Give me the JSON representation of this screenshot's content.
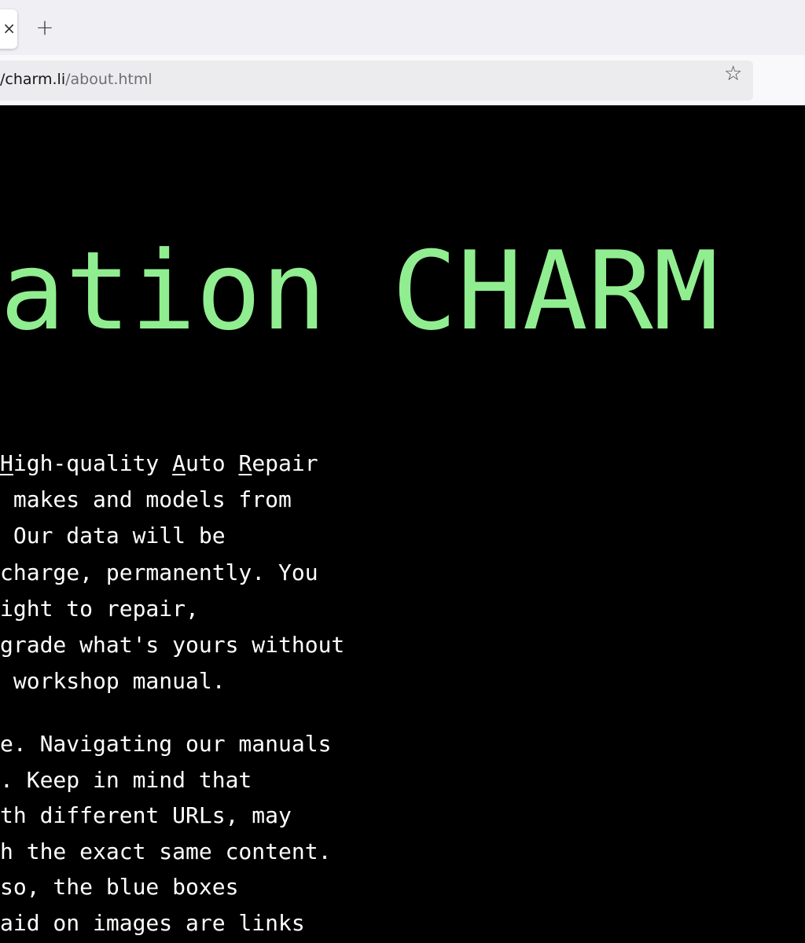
{
  "browser": {
    "tab_close": "×",
    "new_tab": "+",
    "url_host": "/charm.li",
    "url_path": "/about.html",
    "bookmark_icon": "star-icon"
  },
  "page": {
    "heading": "ation CHARM",
    "heading_color": "#90ee90",
    "paragraph1": {
      "line1": {
        "u1": "H",
        "t1": "igh-quality ",
        "u2": "A",
        "t2": "uto ",
        "u3": "R",
        "t3": "epair"
      },
      "lines": [
        " makes and models from",
        " Our data will be",
        "charge, permanently. You",
        "ight to repair,",
        "grade what's yours without",
        " workshop manual."
      ]
    },
    "paragraph2": {
      "lines": [
        "e. Navigating our manuals",
        ". Keep in mind that",
        "th different URLs, may",
        "h the exact same content.",
        "so, the blue boxes",
        "aid on images are links"
      ]
    }
  }
}
